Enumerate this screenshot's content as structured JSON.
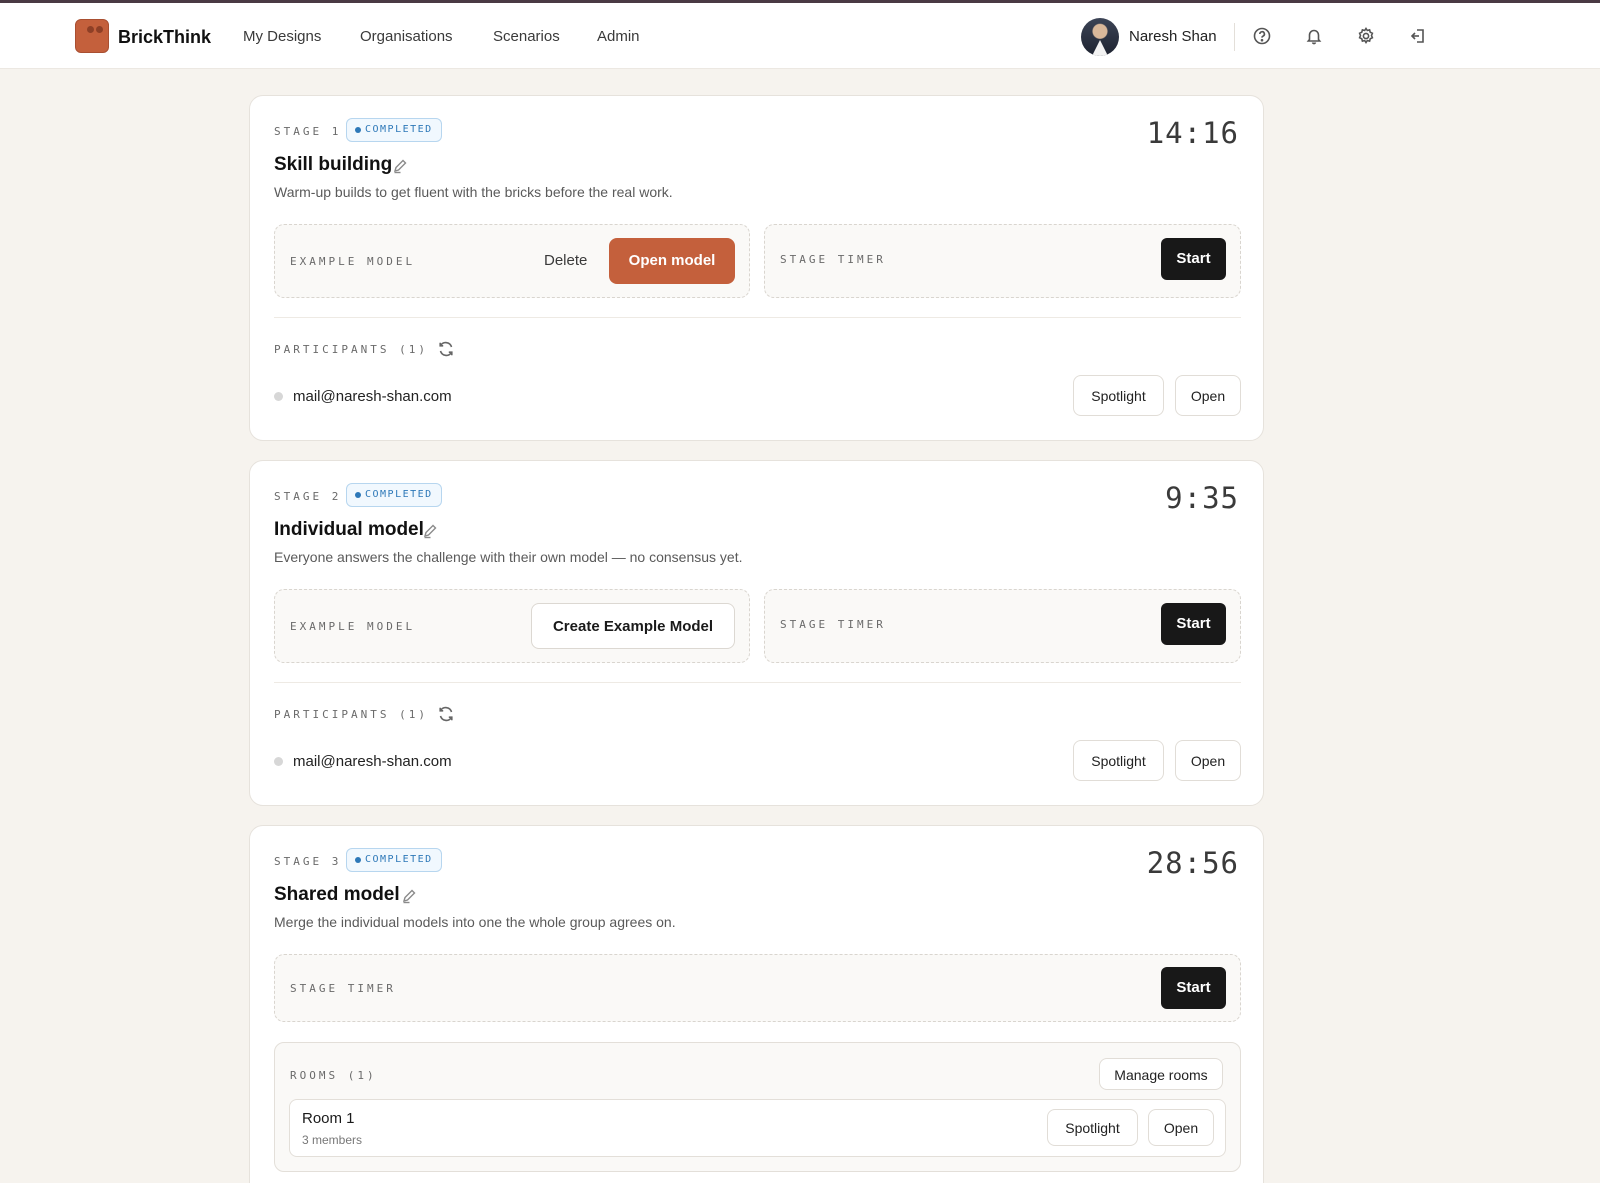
{
  "app": {
    "brand": "BrickThink",
    "nav": [
      "My Designs",
      "Organisations",
      "Scenarios",
      "Admin"
    ],
    "user_name": "Naresh Shan",
    "icons": [
      "help-icon",
      "bell-icon",
      "gear-icon",
      "logout-icon"
    ],
    "colors": {
      "accent": "#c4603c",
      "dark_button": "#181818",
      "badge_blue": "#2d78b8",
      "page_bg": "#f6f3ee"
    }
  },
  "stages": [
    {
      "label": "STAGE 1",
      "status": "COMPLETED",
      "title": "Skill building",
      "description": "Warm-up builds to get fluent with the bricks before the real work.",
      "timer": "14:16",
      "example_model_label": "EXAMPLE MODEL",
      "delete_label": "Delete",
      "open_model_label": "Open model",
      "stage_timer_label": "STAGE TIMER",
      "start_label": "Start",
      "participants_label": "PARTICIPANTS (1)",
      "participants": [
        {
          "email": "mail@naresh-shan.com",
          "spotlight": "Spotlight",
          "open": "Open"
        }
      ]
    },
    {
      "label": "STAGE 2",
      "status": "COMPLETED",
      "title": "Individual model",
      "description": "Everyone answers the challenge with their own model — no consensus yet.",
      "timer": "9:35",
      "example_model_label": "EXAMPLE MODEL",
      "create_example_label": "Create Example Model",
      "stage_timer_label": "STAGE TIMER",
      "start_label": "Start",
      "participants_label": "PARTICIPANTS (1)",
      "participants": [
        {
          "email": "mail@naresh-shan.com",
          "spotlight": "Spotlight",
          "open": "Open"
        }
      ]
    },
    {
      "label": "STAGE 3",
      "status": "COMPLETED",
      "title": "Shared model",
      "description": "Merge the individual models into one the whole group agrees on.",
      "timer": "28:56",
      "stage_timer_label": "STAGE TIMER",
      "start_label": "Start",
      "rooms_label": "ROOMS (1)",
      "manage_rooms_label": "Manage rooms",
      "rooms": [
        {
          "name": "Room 1",
          "members": "3 members",
          "spotlight": "Spotlight",
          "open": "Open"
        }
      ]
    }
  ]
}
